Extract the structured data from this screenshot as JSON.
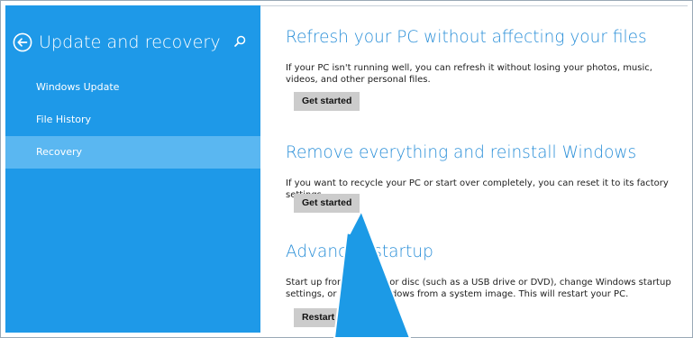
{
  "sidebar": {
    "title": "Update and recovery",
    "back_icon": "back-arrow-circle-icon",
    "search_icon": "search-icon",
    "items": [
      {
        "label": "Windows Update",
        "selected": false
      },
      {
        "label": "File History",
        "selected": false
      },
      {
        "label": "Recovery",
        "selected": true
      }
    ]
  },
  "sections": {
    "refresh": {
      "title": "Refresh your PC without affecting your files",
      "description": "If your PC isn't running well, you can refresh it without losing your photos, music, videos, and other personal files.",
      "button": "Get started"
    },
    "remove": {
      "title": "Remove everything and reinstall Windows",
      "description": "If you want to recycle your PC or start over completely, you can reset it to its factory settings.",
      "button": "Get started"
    },
    "advanced": {
      "title": "Advanced startup",
      "description": "Start up from a device or disc (such as a USB drive or DVD), change Windows startup settings, or restore Windows from a system image. This will restart your PC.",
      "button": "Restart now"
    }
  },
  "colors": {
    "sidebar_bg": "#1e99e8",
    "sidebar_selected": "#5ab7f1",
    "heading": "#2a8fd8",
    "button_bg": "#cccccc",
    "annotation_arrow": "#1c9ae6"
  }
}
